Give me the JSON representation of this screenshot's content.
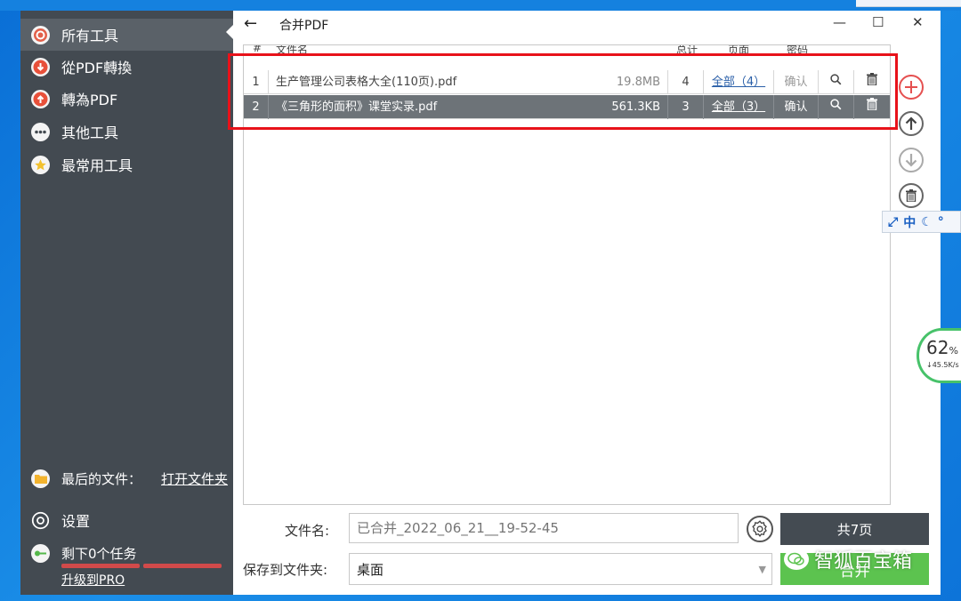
{
  "sidebar": {
    "items": [
      {
        "label": "所有工具",
        "icon": "target-icon"
      },
      {
        "label": "從PDF轉換",
        "icon": "arrow-down-icon"
      },
      {
        "label": "轉為PDF",
        "icon": "arrow-up-icon"
      },
      {
        "label": "其他工具",
        "icon": "more-icon"
      },
      {
        "label": "最常用工具",
        "icon": "star-icon"
      }
    ],
    "last_files_label": "最后的文件：",
    "open_folder_label": "打开文件夹",
    "settings_label": "设置",
    "tasks_label": "剩下0个任务",
    "upgrade_label": "升级到PRO"
  },
  "window": {
    "title": "合并PDF",
    "back": "←",
    "minimize": "—",
    "maximize": "☐",
    "close": "✕"
  },
  "table": {
    "headers": {
      "index": "#",
      "name": "文件名",
      "total": "总计",
      "pages": "页面",
      "password": "密码"
    },
    "rows": [
      {
        "index": "1",
        "name": "生产管理公司表格大全(110页).pdf",
        "size": "19.8MB",
        "total": "4",
        "pages": "全部（4）",
        "password": "确认"
      },
      {
        "index": "2",
        "name": "《三角形的面积》课堂实录.pdf",
        "size": "561.3KB",
        "total": "3",
        "pages": "全部（3）",
        "password": "确认"
      }
    ]
  },
  "form": {
    "filename_label": "文件名:",
    "filename_value": "已合并_2022_06_21__19-52-45",
    "total_pages_label": "共7页",
    "save_folder_label": "保存到文件夹:",
    "save_folder_value": "桌面",
    "merge_label": "合并"
  },
  "watermark": {
    "text": "智狐百宝箱"
  },
  "ime": {
    "mode": "中"
  },
  "speed": {
    "percent": "62",
    "percent_unit": "%",
    "rate": "↓45.5K/s"
  },
  "colors": {
    "sidebar": "#434a51",
    "accent_red": "#e8121a",
    "merge_green": "#5cc34f",
    "row_selected": "#6d7378"
  }
}
